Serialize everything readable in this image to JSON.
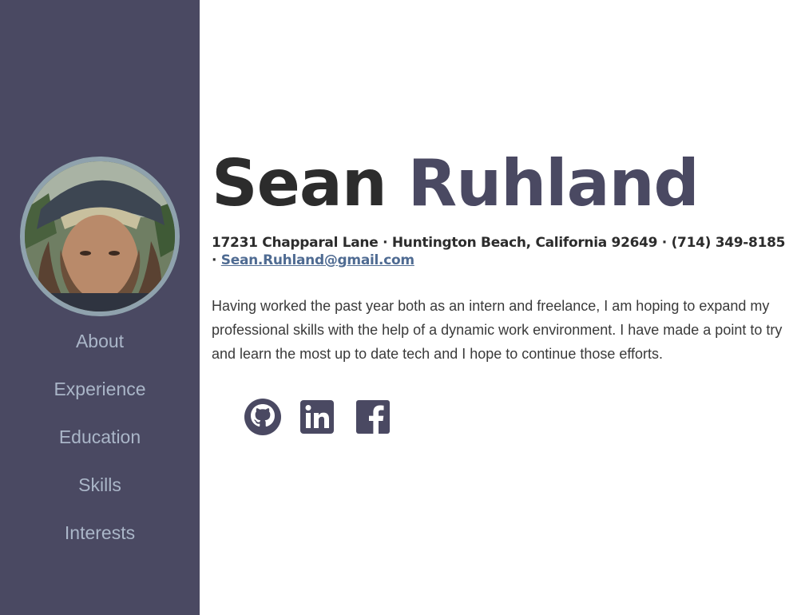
{
  "sidebar": {
    "nav": [
      "About",
      "Experience",
      "Education",
      "Skills",
      "Interests"
    ]
  },
  "header": {
    "first_name": "Sean",
    "last_name": "Ruhland"
  },
  "contact": {
    "address": "17231 Chapparal Lane · Huntington Beach, California 92649 · (714) 349-8185 · ",
    "email": "Sean.Ruhland@gmail.com"
  },
  "about_text": "Having worked the past year both as an intern and freelance, I am hoping to expand my professional skills with the help of a dynamic work environment. I have made a point to try and learn the most up to date tech and I hope to continue those efforts.",
  "social": {
    "icons": [
      "github-icon",
      "linkedin-icon",
      "facebook-icon"
    ]
  },
  "colors": {
    "sidebar_bg": "#4a4962",
    "nav_text": "#aab6c8",
    "accent": "#4a4962",
    "link": "#4f6b92"
  }
}
